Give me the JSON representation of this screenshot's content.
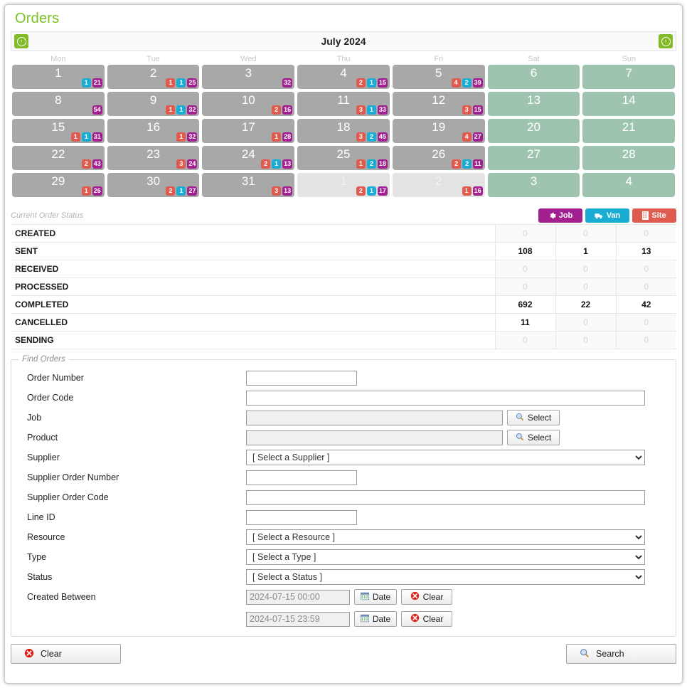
{
  "page": {
    "title": "Orders"
  },
  "calendar": {
    "month_title": "July 2024",
    "prev_label": "‹",
    "next_label": "›",
    "weekdays": [
      "Mon",
      "Tue",
      "Wed",
      "Thu",
      "Fri",
      "Sat",
      "Sun"
    ],
    "weeks": [
      [
        {
          "day": "1",
          "kind": "weekday",
          "badges": [
            {
              "type": "van",
              "value": "1"
            },
            {
              "type": "job",
              "value": "21"
            }
          ]
        },
        {
          "day": "2",
          "kind": "weekday",
          "badges": [
            {
              "type": "site",
              "value": "1"
            },
            {
              "type": "van",
              "value": "1"
            },
            {
              "type": "job",
              "value": "25"
            }
          ]
        },
        {
          "day": "3",
          "kind": "weekday",
          "badges": [
            {
              "type": "job",
              "value": "32"
            }
          ]
        },
        {
          "day": "4",
          "kind": "weekday",
          "badges": [
            {
              "type": "site",
              "value": "2"
            },
            {
              "type": "van",
              "value": "1"
            },
            {
              "type": "job",
              "value": "15"
            }
          ]
        },
        {
          "day": "5",
          "kind": "weekday",
          "badges": [
            {
              "type": "site",
              "value": "4"
            },
            {
              "type": "van",
              "value": "2"
            },
            {
              "type": "job",
              "value": "39"
            }
          ]
        },
        {
          "day": "6",
          "kind": "weekend",
          "badges": []
        },
        {
          "day": "7",
          "kind": "weekend",
          "badges": []
        }
      ],
      [
        {
          "day": "8",
          "kind": "weekday",
          "badges": [
            {
              "type": "job",
              "value": "54"
            }
          ]
        },
        {
          "day": "9",
          "kind": "weekday",
          "badges": [
            {
              "type": "site",
              "value": "1"
            },
            {
              "type": "van",
              "value": "1"
            },
            {
              "type": "job",
              "value": "32"
            }
          ]
        },
        {
          "day": "10",
          "kind": "weekday",
          "badges": [
            {
              "type": "site",
              "value": "2"
            },
            {
              "type": "job",
              "value": "16"
            }
          ]
        },
        {
          "day": "11",
          "kind": "weekday",
          "badges": [
            {
              "type": "site",
              "value": "3"
            },
            {
              "type": "van",
              "value": "1"
            },
            {
              "type": "job",
              "value": "33"
            }
          ]
        },
        {
          "day": "12",
          "kind": "weekday",
          "badges": [
            {
              "type": "site",
              "value": "3"
            },
            {
              "type": "job",
              "value": "15"
            }
          ]
        },
        {
          "day": "13",
          "kind": "weekend",
          "badges": []
        },
        {
          "day": "14",
          "kind": "weekend",
          "badges": []
        }
      ],
      [
        {
          "day": "15",
          "kind": "weekday",
          "badges": [
            {
              "type": "site",
              "value": "1"
            },
            {
              "type": "van",
              "value": "1"
            },
            {
              "type": "job",
              "value": "31"
            }
          ]
        },
        {
          "day": "16",
          "kind": "weekday",
          "badges": [
            {
              "type": "site",
              "value": "1"
            },
            {
              "type": "job",
              "value": "32"
            }
          ]
        },
        {
          "day": "17",
          "kind": "weekday",
          "badges": [
            {
              "type": "site",
              "value": "1"
            },
            {
              "type": "job",
              "value": "28"
            }
          ]
        },
        {
          "day": "18",
          "kind": "weekday",
          "badges": [
            {
              "type": "site",
              "value": "3"
            },
            {
              "type": "van",
              "value": "2"
            },
            {
              "type": "job",
              "value": "45"
            }
          ]
        },
        {
          "day": "19",
          "kind": "weekday",
          "badges": [
            {
              "type": "site",
              "value": "4"
            },
            {
              "type": "job",
              "value": "27"
            }
          ]
        },
        {
          "day": "20",
          "kind": "weekend",
          "badges": []
        },
        {
          "day": "21",
          "kind": "weekend",
          "badges": []
        }
      ],
      [
        {
          "day": "22",
          "kind": "weekday",
          "badges": [
            {
              "type": "site",
              "value": "2"
            },
            {
              "type": "job",
              "value": "43"
            }
          ]
        },
        {
          "day": "23",
          "kind": "weekday",
          "badges": [
            {
              "type": "site",
              "value": "3"
            },
            {
              "type": "job",
              "value": "24"
            }
          ]
        },
        {
          "day": "24",
          "kind": "weekday",
          "badges": [
            {
              "type": "site",
              "value": "2"
            },
            {
              "type": "van",
              "value": "1"
            },
            {
              "type": "job",
              "value": "13"
            }
          ]
        },
        {
          "day": "25",
          "kind": "weekday",
          "badges": [
            {
              "type": "site",
              "value": "1"
            },
            {
              "type": "van",
              "value": "2"
            },
            {
              "type": "job",
              "value": "18"
            }
          ]
        },
        {
          "day": "26",
          "kind": "weekday",
          "badges": [
            {
              "type": "site",
              "value": "2"
            },
            {
              "type": "van",
              "value": "2"
            },
            {
              "type": "job",
              "value": "11"
            }
          ]
        },
        {
          "day": "27",
          "kind": "weekend",
          "badges": []
        },
        {
          "day": "28",
          "kind": "weekend",
          "badges": []
        }
      ],
      [
        {
          "day": "29",
          "kind": "weekday",
          "badges": [
            {
              "type": "site",
              "value": "1"
            },
            {
              "type": "job",
              "value": "26"
            }
          ]
        },
        {
          "day": "30",
          "kind": "weekday",
          "badges": [
            {
              "type": "site",
              "value": "2"
            },
            {
              "type": "van",
              "value": "1"
            },
            {
              "type": "job",
              "value": "27"
            }
          ]
        },
        {
          "day": "31",
          "kind": "weekday",
          "badges": [
            {
              "type": "site",
              "value": "3"
            },
            {
              "type": "job",
              "value": "13"
            }
          ]
        },
        {
          "day": "1",
          "kind": "other",
          "badges": [
            {
              "type": "site",
              "value": "2"
            },
            {
              "type": "van",
              "value": "1"
            },
            {
              "type": "job",
              "value": "17"
            }
          ]
        },
        {
          "day": "2",
          "kind": "other",
          "badges": [
            {
              "type": "site",
              "value": "1"
            },
            {
              "type": "job",
              "value": "16"
            }
          ]
        },
        {
          "day": "3",
          "kind": "weekend",
          "badges": []
        },
        {
          "day": "4",
          "kind": "weekend",
          "badges": []
        }
      ]
    ]
  },
  "status": {
    "section_label": "Current Order Status",
    "columns": [
      {
        "key": "job",
        "label": "Job",
        "icon": "gear-icon",
        "color": "#a21f8f"
      },
      {
        "key": "van",
        "label": "Van",
        "icon": "truck-icon",
        "color": "#1bacd4"
      },
      {
        "key": "site",
        "label": "Site",
        "icon": "building-icon",
        "color": "#e05b4f"
      }
    ],
    "rows": [
      {
        "name": "CREATED",
        "job": "0",
        "van": "0",
        "site": "0"
      },
      {
        "name": "SENT",
        "job": "108",
        "van": "1",
        "site": "13"
      },
      {
        "name": "RECEIVED",
        "job": "0",
        "van": "0",
        "site": "0"
      },
      {
        "name": "PROCESSED",
        "job": "0",
        "van": "0",
        "site": "0"
      },
      {
        "name": "COMPLETED",
        "job": "692",
        "van": "22",
        "site": "42"
      },
      {
        "name": "CANCELLED",
        "job": "11",
        "van": "0",
        "site": "0"
      },
      {
        "name": "SENDING",
        "job": "0",
        "van": "0",
        "site": "0"
      }
    ]
  },
  "find": {
    "legend": "Find Orders",
    "labels": {
      "order_number": "Order Number",
      "order_code": "Order Code",
      "job": "Job",
      "product": "Product",
      "supplier": "Supplier",
      "supplier_order_number": "Supplier Order Number",
      "supplier_order_code": "Supplier Order Code",
      "line_id": "Line ID",
      "resource": "Resource",
      "type": "Type",
      "status": "Status",
      "created_between": "Created Between"
    },
    "values": {
      "order_number": "",
      "order_code": "",
      "job": "",
      "product": "",
      "supplier": "[ Select a Supplier ]",
      "supplier_order_number": "",
      "supplier_order_code": "",
      "line_id": "",
      "resource": "[ Select a Resource ]",
      "type": "[ Select a Type ]",
      "status": "[ Select a Status ]",
      "created_from": "2024-07-15 00:00",
      "created_to": "2024-07-15 23:59"
    },
    "buttons": {
      "select": "Select",
      "date": "Date",
      "clear": "Clear"
    }
  },
  "footer": {
    "clear": "Clear",
    "search": "Search"
  }
}
